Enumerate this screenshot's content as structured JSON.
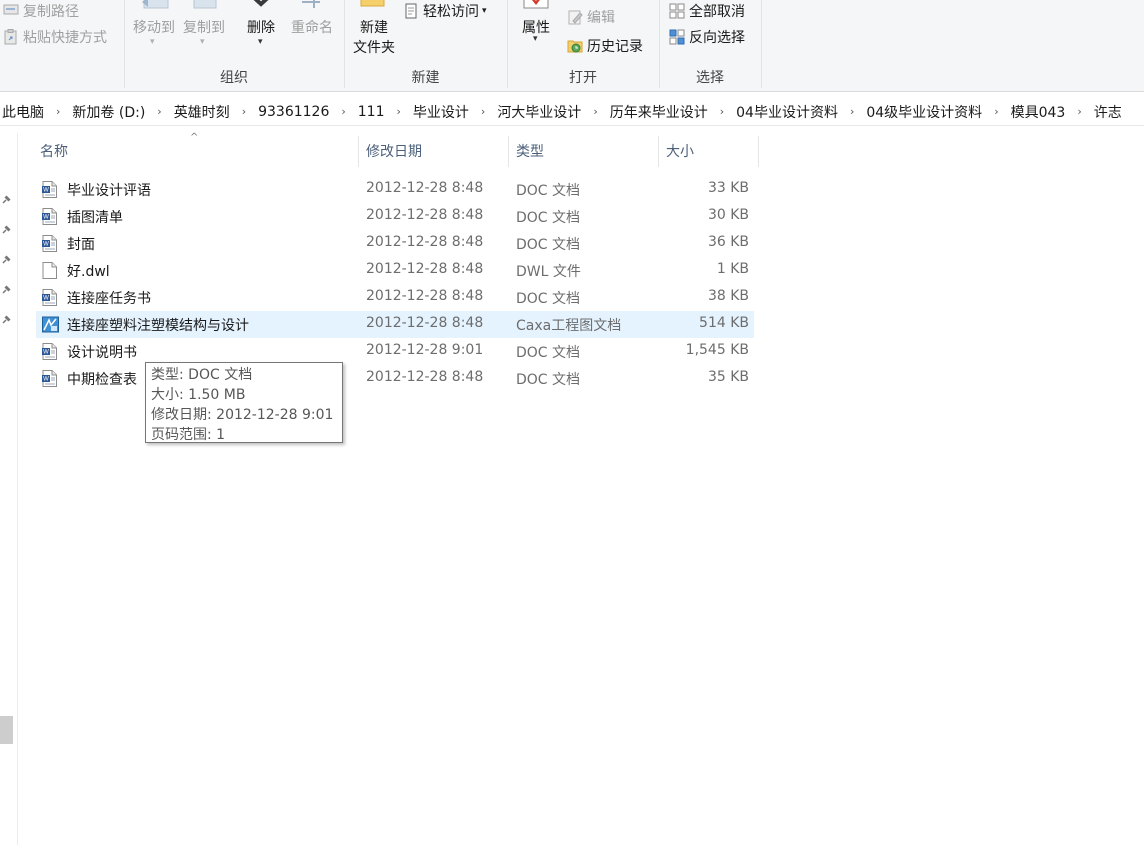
{
  "ribbon": {
    "clipboard": {
      "copy_path": "复制路径",
      "paste_shortcut": "粘贴快捷方式"
    },
    "organize": {
      "move_to": "移动到",
      "copy_to": "复制到",
      "delete": "删除",
      "rename": "重命名",
      "group_label": "组织"
    },
    "new": {
      "new_folder_line1": "新建",
      "new_folder_line2": "文件夹",
      "easy_access": "轻松访问",
      "group_label": "新建"
    },
    "open": {
      "properties": "属性",
      "edit": "编辑",
      "history": "历史记录",
      "group_label": "打开"
    },
    "select": {
      "select_none": "全部取消",
      "invert_selection": "反向选择",
      "group_label": "选择"
    }
  },
  "breadcrumb": [
    "此电脑",
    "新加卷 (D:)",
    "英雄时刻",
    "93361126",
    "111",
    "毕业设计",
    "河大毕业设计",
    "历年来毕业设计",
    "04毕业设计资料",
    "04级毕业设计资料",
    "模具043",
    "许志"
  ],
  "columns": {
    "name": "名称",
    "date": "修改日期",
    "type": "类型",
    "size": "大小"
  },
  "files": [
    {
      "name": "毕业设计评语",
      "date": "2012-12-28 8:48",
      "type": "DOC 文档",
      "size": "33 KB",
      "icon": "word-doc-icon"
    },
    {
      "name": "插图清单",
      "date": "2012-12-28 8:48",
      "type": "DOC 文档",
      "size": "30 KB",
      "icon": "word-doc-icon"
    },
    {
      "name": "封面",
      "date": "2012-12-28 8:48",
      "type": "DOC 文档",
      "size": "36 KB",
      "icon": "word-doc-icon"
    },
    {
      "name": "好.dwl",
      "date": "2012-12-28 8:48",
      "type": "DWL 文件",
      "size": "1 KB",
      "icon": "blank-file-icon"
    },
    {
      "name": "连接座任务书",
      "date": "2012-12-28 8:48",
      "type": "DOC 文档",
      "size": "38 KB",
      "icon": "word-doc-icon"
    },
    {
      "name": "连接座塑料注塑模结构与设计",
      "date": "2012-12-28 8:48",
      "type": "Caxa工程图文档",
      "size": "514 KB",
      "icon": "caxa-drawing-icon",
      "selected": true
    },
    {
      "name": "设计说明书",
      "date": "2012-12-28 9:01",
      "type": "DOC 文档",
      "size": "1,545 KB",
      "icon": "word-doc-icon"
    },
    {
      "name": "中期检查表",
      "date": "2012-12-28 8:48",
      "type": "DOC 文档",
      "size": "35 KB",
      "icon": "word-doc-icon"
    }
  ],
  "tooltip": {
    "type_line": "类型: DOC 文档",
    "size_line": "大小: 1.50 MB",
    "date_line": "修改日期: 2012-12-28 9:01",
    "pages_line": "页码范围: 1"
  },
  "colors": {
    "selection": "#e5f3ff",
    "header_text": "#4c607a",
    "ribbon_bg": "#f5f6f7"
  }
}
